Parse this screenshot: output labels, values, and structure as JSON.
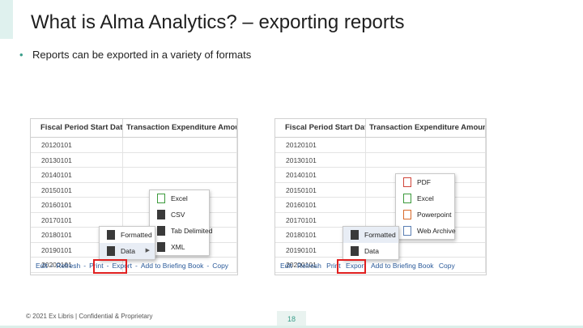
{
  "slide": {
    "title": "What is Alma Analytics? – exporting reports",
    "bullet": "Reports can be exported in a variety of formats",
    "footer": "© 2021 Ex Libris | Confidential & Proprietary",
    "page_number": "18"
  },
  "colors": {
    "accent": "#3a9e8a",
    "highlight": "#e02020",
    "link": "#2a5a9a"
  },
  "report_left": {
    "columns": [
      "Fiscal Period Start Date",
      "Transaction Expenditure Amount"
    ],
    "rows": [
      "20120101",
      "20130101",
      "20140101",
      "20150101",
      "20160101",
      "20170101",
      "20180101",
      "20190101",
      "20200101"
    ],
    "links": [
      "Edit",
      "-",
      "Refresh",
      "-",
      "Print",
      "-",
      "Export",
      "-",
      "Add to Briefing Book",
      "-",
      "Copy"
    ],
    "export_menu": [
      "Formatted",
      "Data"
    ],
    "data_submenu": [
      "Excel",
      "CSV",
      "Tab Delimited",
      "XML"
    ]
  },
  "report_right": {
    "columns": [
      "Fiscal Period Start Date",
      "Transaction Expenditure Amount"
    ],
    "rows": [
      "20120101",
      "20130101",
      "20140101",
      "20150101",
      "20160101",
      "20170101",
      "20180101",
      "20190101",
      "20200101"
    ],
    "links": [
      "Edit",
      "Refresh",
      "Print",
      "Export",
      "Add to Briefing Book",
      "Copy"
    ],
    "export_menu": [
      "Formatted",
      "Data"
    ],
    "formatted_submenu": [
      "PDF",
      "Excel",
      "Powerpoint",
      "Web Archive"
    ]
  }
}
